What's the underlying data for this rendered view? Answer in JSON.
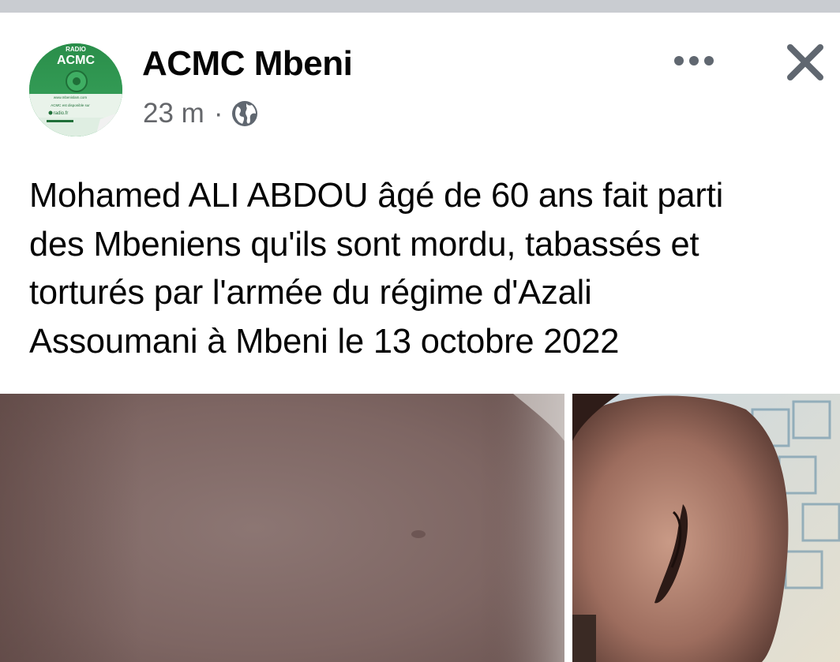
{
  "post": {
    "author": "ACMC Mbeni",
    "time": "23 m",
    "separator": "·",
    "audience_icon": "globe-icon",
    "avatar": {
      "top_text": "RADIO",
      "brand": "ACMC",
      "line1": "www.mbenislam.com",
      "line2": "ACMC est disponible sur",
      "line3": "radio.fr"
    },
    "text_lines": [
      "Mohamed ALI ABDOU âgé de 60 ans fait parti",
      "des Mbeniens qu'ils sont mordu, tabassés et",
      "torturés par l'armée du régime d'Azali",
      "Assoumani à Mbeni le 13 octobre 2022"
    ],
    "actions": {
      "more_icon": "more-horizontal-icon",
      "close_icon": "close-icon"
    }
  },
  "colors": {
    "top_bar": "#c9ccd1",
    "secondary_text": "#65676b",
    "icon_gray": "#606770",
    "avatar_green": "#2e9a52"
  }
}
